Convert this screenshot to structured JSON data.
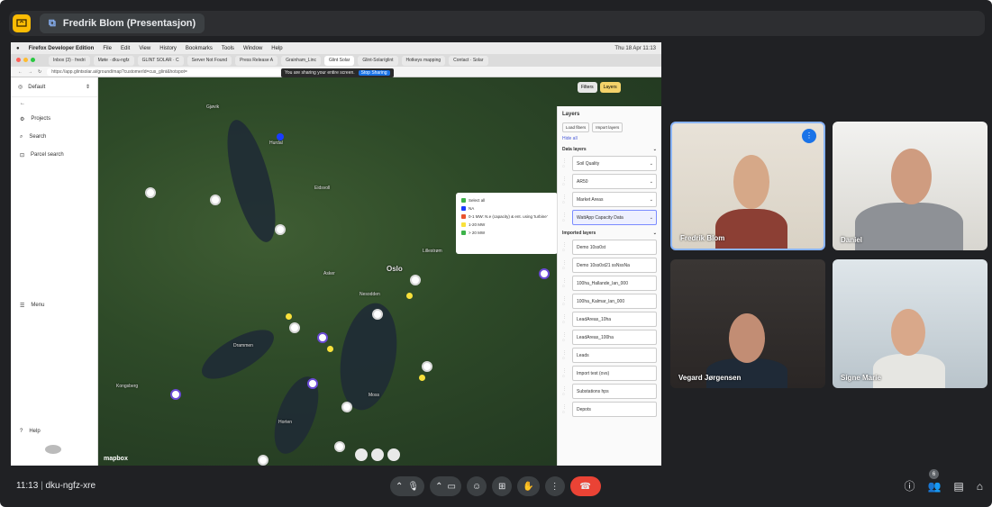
{
  "presentation": {
    "title": "Fredrik Blom (Presentasjon)"
  },
  "mac_menu": {
    "items": [
      "Firefox Developer Edition",
      "File",
      "Edit",
      "View",
      "History",
      "Bookmarks",
      "Tools",
      "Window",
      "Help"
    ],
    "datetime": "Thu 18 Apr 11:13"
  },
  "browser": {
    "tabs": [
      "Inbox (3) · fredri",
      "Møte · dku-ngfz",
      "GLINT SOLAR · C",
      "Server Not Found",
      "Press Release A",
      "Grainham_Linc",
      "Glint Solar",
      "Glint-Solar/glint",
      "Hotkeys mapping",
      "Contact · Solar"
    ],
    "url": "https://app.glintsolar.ai/ground/map?customerId=cus_glint&hotspot=",
    "share_notice": "You are sharing your entire screen.",
    "stop_sharing": "Stop Sharing"
  },
  "sidebar": {
    "workspace": "Default",
    "items": [
      {
        "label": "Projects",
        "icon": "projects-icon"
      },
      {
        "label": "Search",
        "icon": "search-icon"
      },
      {
        "label": "Parcel search",
        "icon": "parcel-icon"
      }
    ],
    "menu": "Menu",
    "help": "Help"
  },
  "map": {
    "city": "Oslo",
    "attribution": "mapbox",
    "filters_label": "Filters",
    "layers_label": "Layers",
    "places": [
      "Hurdal",
      "Gjøvik",
      "Eidsvoll",
      "Lillestrøm",
      "Asker",
      "Drammen",
      "Moss",
      "Nesodden",
      "Kongsberg",
      "Horten"
    ]
  },
  "legend": {
    "title": "Select all",
    "items": [
      {
        "label": "NA",
        "color": "#1a3cff"
      },
      {
        "label": "0-1 MW: N.e (capacity) & ent. using 'turbine'",
        "color": "#e9532e"
      },
      {
        "label": "1-20 MW",
        "color": "#f9e13b"
      },
      {
        "label": "> 20 MW",
        "color": "#3db34a"
      }
    ]
  },
  "layers_panel": {
    "title": "Layers",
    "load_button": "Load fibers",
    "import_button": "Import layers",
    "hide_all": "Hide all",
    "data_section": "Data layers",
    "data_layers": [
      "Soil Quality",
      "AR50",
      "Market Areas",
      "WattApp Capacity Data"
    ],
    "imported_section": "Imported layers",
    "imported_layers": [
      "Demo 10ss0st",
      "Demo 10ss0st21 ssNssNa",
      "100ha_Hallande_lan_000",
      "100ha_Kalmar_lan_000",
      "LeadAreas_10ha",
      "LeadAreas_100ha",
      "Leads",
      "Import test (ovs)",
      "Substations hps",
      "Depots"
    ]
  },
  "participants": [
    {
      "name": "Fredrik Blom",
      "speaking": true
    },
    {
      "name": "Daniel",
      "speaking": false
    },
    {
      "name": "Vegard Jørgensen",
      "speaking": false
    },
    {
      "name": "Signe Marie",
      "speaking": false
    }
  ],
  "controls": {
    "time": "11:13",
    "meeting_code": "dku-ngfz-xre",
    "participant_count": "6"
  }
}
